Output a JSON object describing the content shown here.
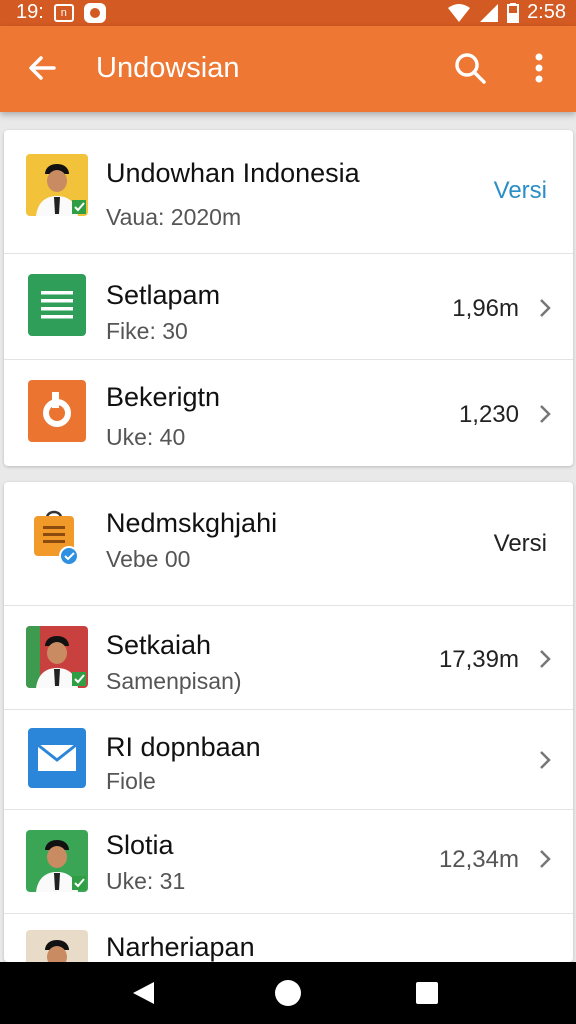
{
  "status_bar": {
    "left_text": "19:",
    "box_text": "n",
    "time": "2:58"
  },
  "app_bar": {
    "title": "Undowsian",
    "back_icon": "arrow-back-icon",
    "search_icon": "search-icon",
    "menu_icon": "more-vert-icon"
  },
  "card1": {
    "items": [
      {
        "name": "Undowhan Indonesia",
        "sub": "Vaua: 2020m",
        "value": "Versi",
        "icon": "profile-photo-icon"
      },
      {
        "name": "Setlapam",
        "sub": "Fike: 30",
        "value": "1,96m",
        "icon": "document-icon"
      },
      {
        "name": "Bekerigtn",
        "sub": "Uke: 40",
        "value": "1,230",
        "icon": "orange-app-icon"
      }
    ]
  },
  "card2": {
    "items": [
      {
        "name": "Nedmskghjahi",
        "sub": "Vebe 00",
        "value": "Versi",
        "icon": "shopping-bag-check-icon"
      },
      {
        "name": "Setkaiah",
        "sub": "Samenpisan)",
        "value": "17,39m",
        "icon": "profile-photo-icon"
      },
      {
        "name": "RI dopnbaan",
        "sub": "Fiole",
        "value": "",
        "icon": "mail-icon"
      },
      {
        "name": "Slotia",
        "sub": "Uke: 31",
        "value": "12,34m",
        "icon": "profile-photo-icon"
      },
      {
        "name": "Narheriapan",
        "sub": "",
        "value": "",
        "icon": "profile-photo-icon"
      }
    ]
  },
  "colors": {
    "accent": "#ed7733",
    "status_bar": "#d35a22",
    "link": "#2a8ec8"
  }
}
